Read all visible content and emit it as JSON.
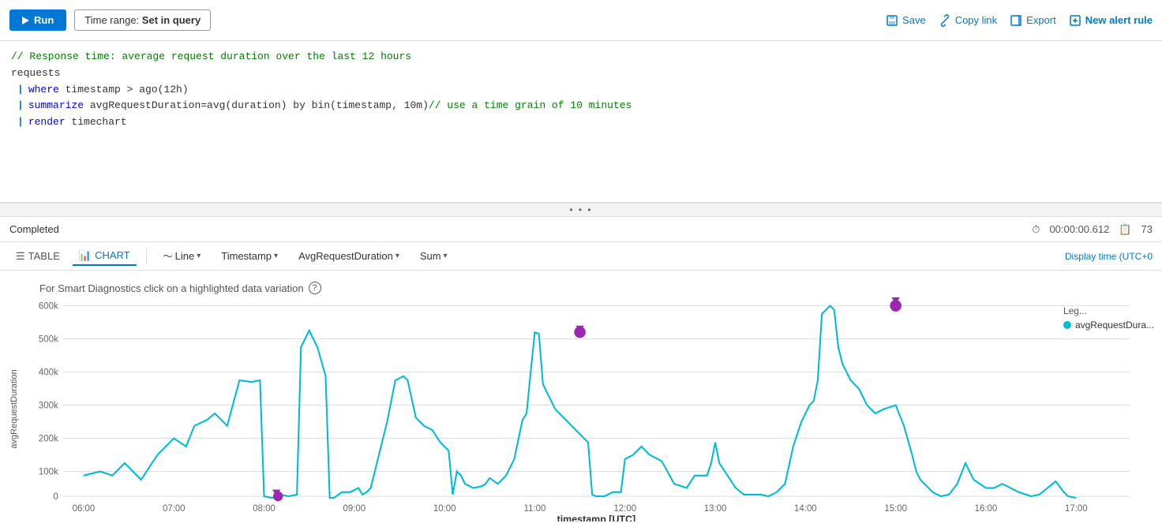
{
  "toolbar": {
    "run_label": "Run",
    "time_range_label": "Time range:",
    "time_range_value": "Set in query",
    "save_label": "Save",
    "copy_link_label": "Copy link",
    "export_label": "Export",
    "new_alert_label": "New alert rule"
  },
  "editor": {
    "lines": [
      {
        "type": "comment",
        "text": "// Response time: average request duration over the last 12 hours"
      },
      {
        "type": "plain",
        "text": "requests"
      },
      {
        "type": "pipe",
        "keyword": "where",
        "rest": " timestamp > ago(12h)"
      },
      {
        "type": "pipe",
        "keyword": "summarize",
        "rest": " avgRequestDuration=avg(duration) by bin(timestamp, 10m) // use a time grain of 10 minutes"
      },
      {
        "type": "pipe",
        "keyword": "render",
        "rest": " timechart"
      }
    ]
  },
  "status": {
    "completed_label": "Completed",
    "duration_label": "00:00:00.612",
    "rows_label": "73"
  },
  "chart_toolbar": {
    "table_label": "TABLE",
    "chart_label": "CHART",
    "line_label": "Line",
    "timestamp_label": "Timestamp",
    "avg_label": "AvgRequestDuration",
    "sum_label": "Sum",
    "display_time_label": "Display time (UTC+0"
  },
  "chart": {
    "smart_diag_text": "For Smart Diagnostics click on a highlighted data variation",
    "y_label": "avgRequestDuration",
    "x_label": "timestamp [UTC]",
    "y_ticks": [
      "600k",
      "500k",
      "400k",
      "300k",
      "200k",
      "100k",
      "0"
    ],
    "x_ticks": [
      "06:00",
      "07:00",
      "08:00",
      "09:00",
      "10:00",
      "11:00",
      "12:00",
      "13:00",
      "14:00",
      "15:00",
      "16:00",
      "17:00"
    ],
    "legend_label": "Leg...",
    "legend_series": "avgRequestDura..."
  }
}
